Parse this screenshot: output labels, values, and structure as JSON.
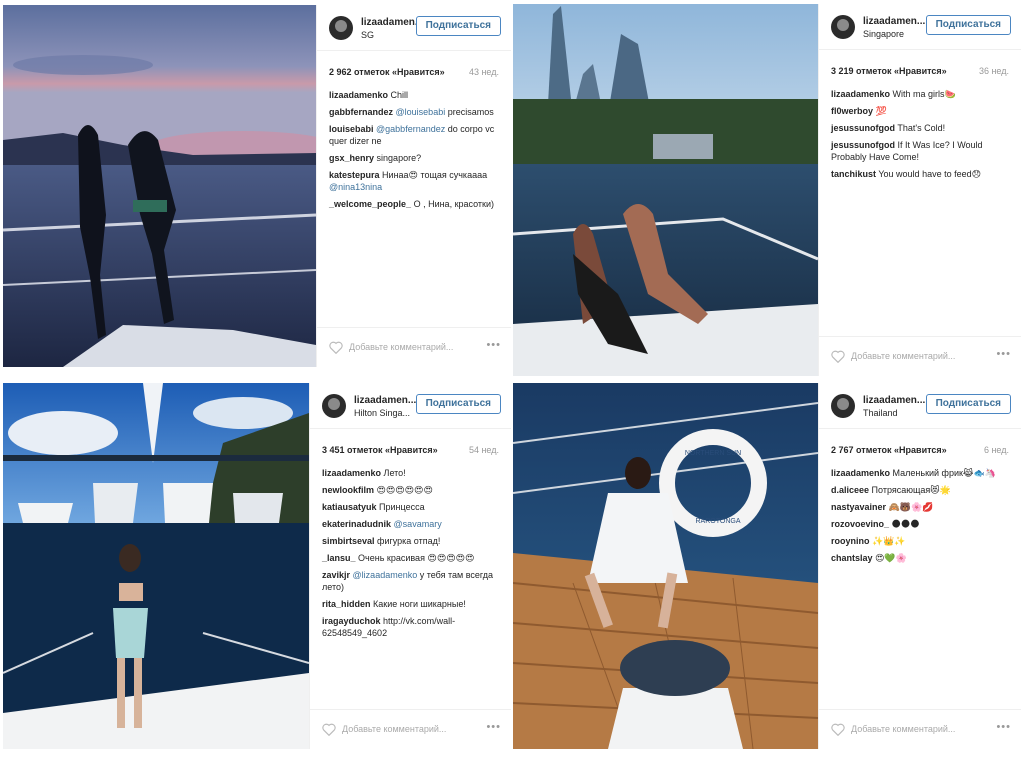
{
  "common": {
    "follow_label": "Подписаться",
    "add_comment_placeholder": "Добавьте комментарий...",
    "more_label": "•••"
  },
  "posts": [
    {
      "username": "lizaadamen...",
      "location": "SG",
      "likes": "2 962 отметок «Нравится»",
      "age": "43 нед.",
      "comments": [
        {
          "user": "lizaadamenko",
          "text": "Chill"
        },
        {
          "user": "gabbfernandez",
          "mention": "@louisebabi",
          "text": "precisamos"
        },
        {
          "user": "louisebabi",
          "mention": "@gabbfernandez",
          "text": "do corpo vc quer dizer ne"
        },
        {
          "user": "gsx_henry",
          "text": "singapore?"
        },
        {
          "user": "katestepura",
          "text": "Нинаа😍 тощая сучкаааа",
          "mention": "@nina13nina"
        },
        {
          "user": "_welcome_people_",
          "text": "О , Нина, красотки)"
        }
      ]
    },
    {
      "username": "lizaadamen...",
      "location": "Singapore",
      "likes": "3 219 отметок «Нравится»",
      "age": "36 нед.",
      "comments": [
        {
          "user": "lizaadamenko",
          "text": "With ma girls🍉"
        },
        {
          "user": "fl0werboy",
          "text": "💯"
        },
        {
          "user": "jesussunofgod",
          "text": "That's Cold!"
        },
        {
          "user": "jesussunofgod",
          "text": "If It Was Ice? I Would Probably Have Come!"
        },
        {
          "user": "tanchikust",
          "text": "You would have to feed😞"
        }
      ]
    },
    {
      "username": "lizaadamen...",
      "location": "Hilton Singa...",
      "likes": "3 451 отметок «Нравится»",
      "age": "54 нед.",
      "comments": [
        {
          "user": "lizaadamenko",
          "text": "Лето!"
        },
        {
          "user": "newlookfilm",
          "text": "😍😍😍😍😍😍"
        },
        {
          "user": "katiausatyuk",
          "text": "Принцесса"
        },
        {
          "user": "ekaterinadudnik",
          "mention": "@savamary",
          "text": ""
        },
        {
          "user": "simbirtseval",
          "text": "фигурка отпад!"
        },
        {
          "user": "_lansu_",
          "text": "Очень красивая 😍😍😍😍😍"
        },
        {
          "user": "zavikjr",
          "mention": "@lizaadamenko",
          "text": "у тебя там всегда лето)"
        },
        {
          "user": "rita_hidden",
          "text": "Какие ноги шикарные!"
        },
        {
          "user": "iragayduchok",
          "text": "http://vk.com/wall-62548549_4602"
        }
      ]
    },
    {
      "username": "lizaadamen...",
      "location": "Thailand",
      "likes": "2 767 отметок «Нравится»",
      "age": "6 нед.",
      "comments": [
        {
          "user": "lizaadamenko",
          "text": "Маленький фрик😹🐟🦄"
        },
        {
          "user": "d.aliceee",
          "text": "Потрясающая😻🌟"
        },
        {
          "user": "nastyavainer",
          "text": "🙈🐻🌸💋"
        },
        {
          "user": "rozovoevino_",
          "text": "🌑🌑🌑"
        },
        {
          "user": "rooynino",
          "text": "✨👑✨"
        },
        {
          "user": "chantslay",
          "text": "😍💚🌸"
        }
      ]
    }
  ],
  "photo_labels": {
    "lifebuoy_top": "NORTHERN SUN",
    "lifebuoy_bottom": "RAROTONGA"
  }
}
